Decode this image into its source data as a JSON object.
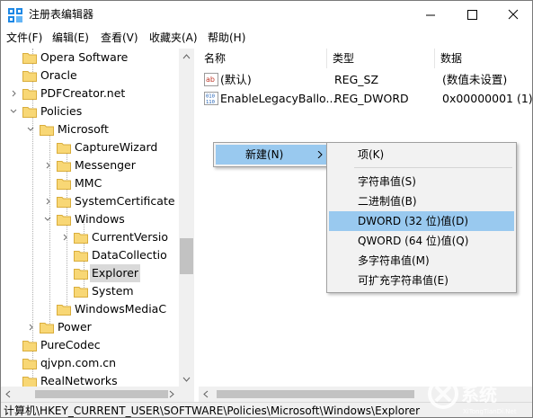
{
  "window": {
    "title": "注册表编辑器",
    "icon": "regedit-icon"
  },
  "menubar": [
    "文件(F)",
    "编辑(E)",
    "查看(V)",
    "收藏夹(A)",
    "帮助(H)"
  ],
  "tree": {
    "rows": [
      {
        "label": "Opera Software",
        "arrow": "",
        "depth": 1
      },
      {
        "label": "Oracle",
        "arrow": "",
        "depth": 1
      },
      {
        "label": "PDFCreator.net",
        "arrow": ">",
        "depth": 1
      },
      {
        "label": "Policies",
        "arrow": "v",
        "depth": 1
      },
      {
        "label": "Microsoft",
        "arrow": "v",
        "depth": 2
      },
      {
        "label": "CaptureWizard",
        "arrow": "",
        "depth": 3
      },
      {
        "label": "Messenger",
        "arrow": ">",
        "depth": 3
      },
      {
        "label": "MMC",
        "arrow": "",
        "depth": 3
      },
      {
        "label": "SystemCertificate",
        "arrow": ">",
        "depth": 3
      },
      {
        "label": "Windows",
        "arrow": "v",
        "depth": 3
      },
      {
        "label": "CurrentVersio",
        "arrow": ">",
        "depth": 4
      },
      {
        "label": "DataCollectio",
        "arrow": "",
        "depth": 4
      },
      {
        "label": "Explorer",
        "arrow": "",
        "depth": 4,
        "selected": true
      },
      {
        "label": "System",
        "arrow": "",
        "depth": 4
      },
      {
        "label": "WindowsMediaC",
        "arrow": "",
        "depth": 3
      },
      {
        "label": "Power",
        "arrow": ">",
        "depth": 2
      },
      {
        "label": "PureCodec",
        "arrow": "",
        "depth": 1
      },
      {
        "label": "qjvpn.com.cn",
        "arrow": "",
        "depth": 1
      },
      {
        "label": "RealNetworks",
        "arrow": "",
        "depth": 1
      }
    ]
  },
  "list": {
    "headers": [
      "名称",
      "类型",
      "数据"
    ],
    "rows": [
      {
        "icon": "string-value-icon",
        "name": "(默认)",
        "type": "REG_SZ",
        "data": "(数值未设置)"
      },
      {
        "icon": "binary-value-icon",
        "name": "EnableLegacyBallo...",
        "type": "REG_DWORD",
        "data": "0x00000001 (1)"
      }
    ]
  },
  "context_menu": {
    "new_label": "新建(N)",
    "submenu": [
      {
        "label": "项(K)"
      },
      {
        "sep": true
      },
      {
        "label": "字符串值(S)"
      },
      {
        "label": "二进制值(B)"
      },
      {
        "label": "DWORD (32 位)值(D)",
        "highlighted": true
      },
      {
        "label": "QWORD (64 位)值(Q)"
      },
      {
        "label": "多字符串值(M)"
      },
      {
        "label": "可扩充字符串值(E)"
      }
    ]
  },
  "statusbar": {
    "path": "计算机\\HKEY_CURRENT_USER\\SOFTWARE\\Policies\\Microsoft\\Windows\\Explorer"
  },
  "colors": {
    "highlight": "#99c9ef",
    "folder": "#f8d775",
    "menu_bg": "#f2f2f2"
  }
}
